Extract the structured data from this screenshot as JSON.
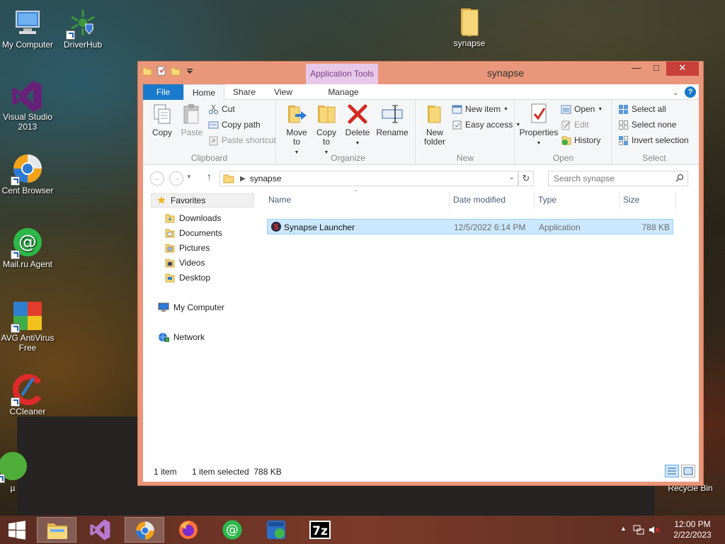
{
  "desktop": {
    "icons": [
      {
        "label": "My Computer"
      },
      {
        "label": "DriverHub"
      },
      {
        "label": "synapse"
      },
      {
        "label": "Visual Studio 2013"
      },
      {
        "label": "Cent Browser"
      },
      {
        "label": "Mail.ru Agent"
      },
      {
        "label": "AVG AntiVirus Free"
      },
      {
        "label": "CCleaner"
      },
      {
        "label": "µ"
      },
      {
        "label": "Recycle Bin"
      }
    ]
  },
  "window": {
    "title": "synapse",
    "contextual_tab": "Application Tools",
    "tabs": {
      "file": "File",
      "home": "Home",
      "share": "Share",
      "view": "View",
      "manage": "Manage"
    },
    "ribbon": {
      "clipboard": {
        "copy": "Copy",
        "paste": "Paste",
        "cut": "Cut",
        "copy_path": "Copy path",
        "paste_shortcut": "Paste shortcut",
        "label": "Clipboard"
      },
      "organize": {
        "move_to": "Move to",
        "copy_to": "Copy to",
        "delete": "Delete",
        "rename": "Rename",
        "label": "Organize"
      },
      "new": {
        "new_folder": "New folder",
        "new_item": "New item",
        "easy_access": "Easy access",
        "label": "New"
      },
      "open": {
        "properties": "Properties",
        "open": "Open",
        "edit": "Edit",
        "history": "History",
        "label": "Open"
      },
      "select": {
        "select_all": "Select all",
        "select_none": "Select none",
        "invert_selection": "Invert selection",
        "label": "Select"
      }
    },
    "address": {
      "path": "synapse",
      "search_placeholder": "Search synapse"
    },
    "nav": {
      "favorites": "Favorites",
      "fav_items": [
        "Downloads",
        "Documents",
        "Pictures",
        "Videos",
        "Desktop"
      ],
      "my_computer": "My Computer",
      "network": "Network"
    },
    "columns": {
      "name": "Name",
      "date": "Date modified",
      "type": "Type",
      "size": "Size"
    },
    "files": [
      {
        "name": "Synapse Launcher",
        "date": "12/5/2022 6:14 PM",
        "type": "Application",
        "size": "788 KB"
      }
    ],
    "status": {
      "count": "1 item",
      "selected": "1 item selected  788 KB"
    }
  },
  "taskbar": {
    "time": "12:00 PM",
    "date": "2/22/2023",
    "apps": [
      "file-explorer",
      "visual-studio",
      "cent-browser",
      "firefox",
      "mail-ru-agent",
      "iobit",
      "7-zip"
    ]
  },
  "colors": {
    "accent": "#1979ca",
    "window_frame": "#e9967a",
    "selection": "#cce8ff",
    "taskbar": "#6b3326",
    "close": "#c9403a"
  }
}
